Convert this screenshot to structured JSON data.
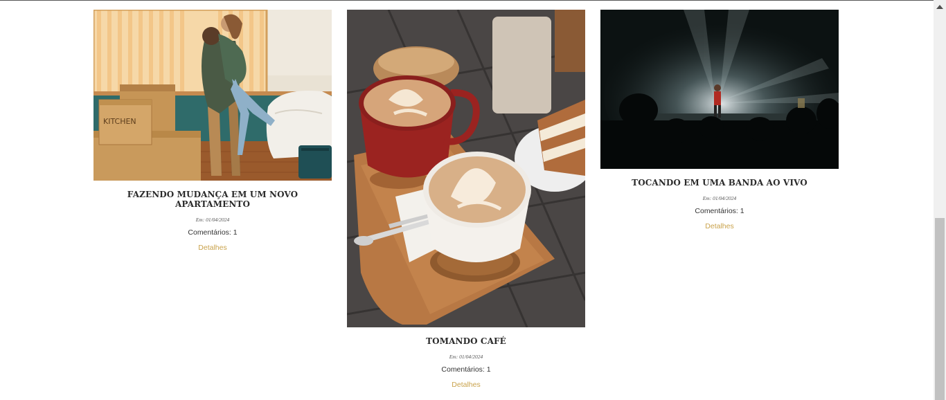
{
  "posts": [
    {
      "title": "FAZENDO MUDANÇA EM UM NOVO APARTAMENTO",
      "date": "Em: 01/04/2024",
      "comments": "Comentários: 1",
      "details": "Detalhes",
      "image_label": "KITCHEN"
    },
    {
      "title": "TOMANDO CAFÉ",
      "date": "Em: 01/04/2024",
      "comments": "Comentários: 1",
      "details": "Detalhes"
    },
    {
      "title": "TOCANDO EM UMA BANDA AO VIVO",
      "date": "Em: 01/04/2024",
      "comments": "Comentários: 1",
      "details": "Detalhes"
    }
  ],
  "colors": {
    "accent": "#c9a24b",
    "title": "#2b2b2b",
    "text": "#333333"
  }
}
